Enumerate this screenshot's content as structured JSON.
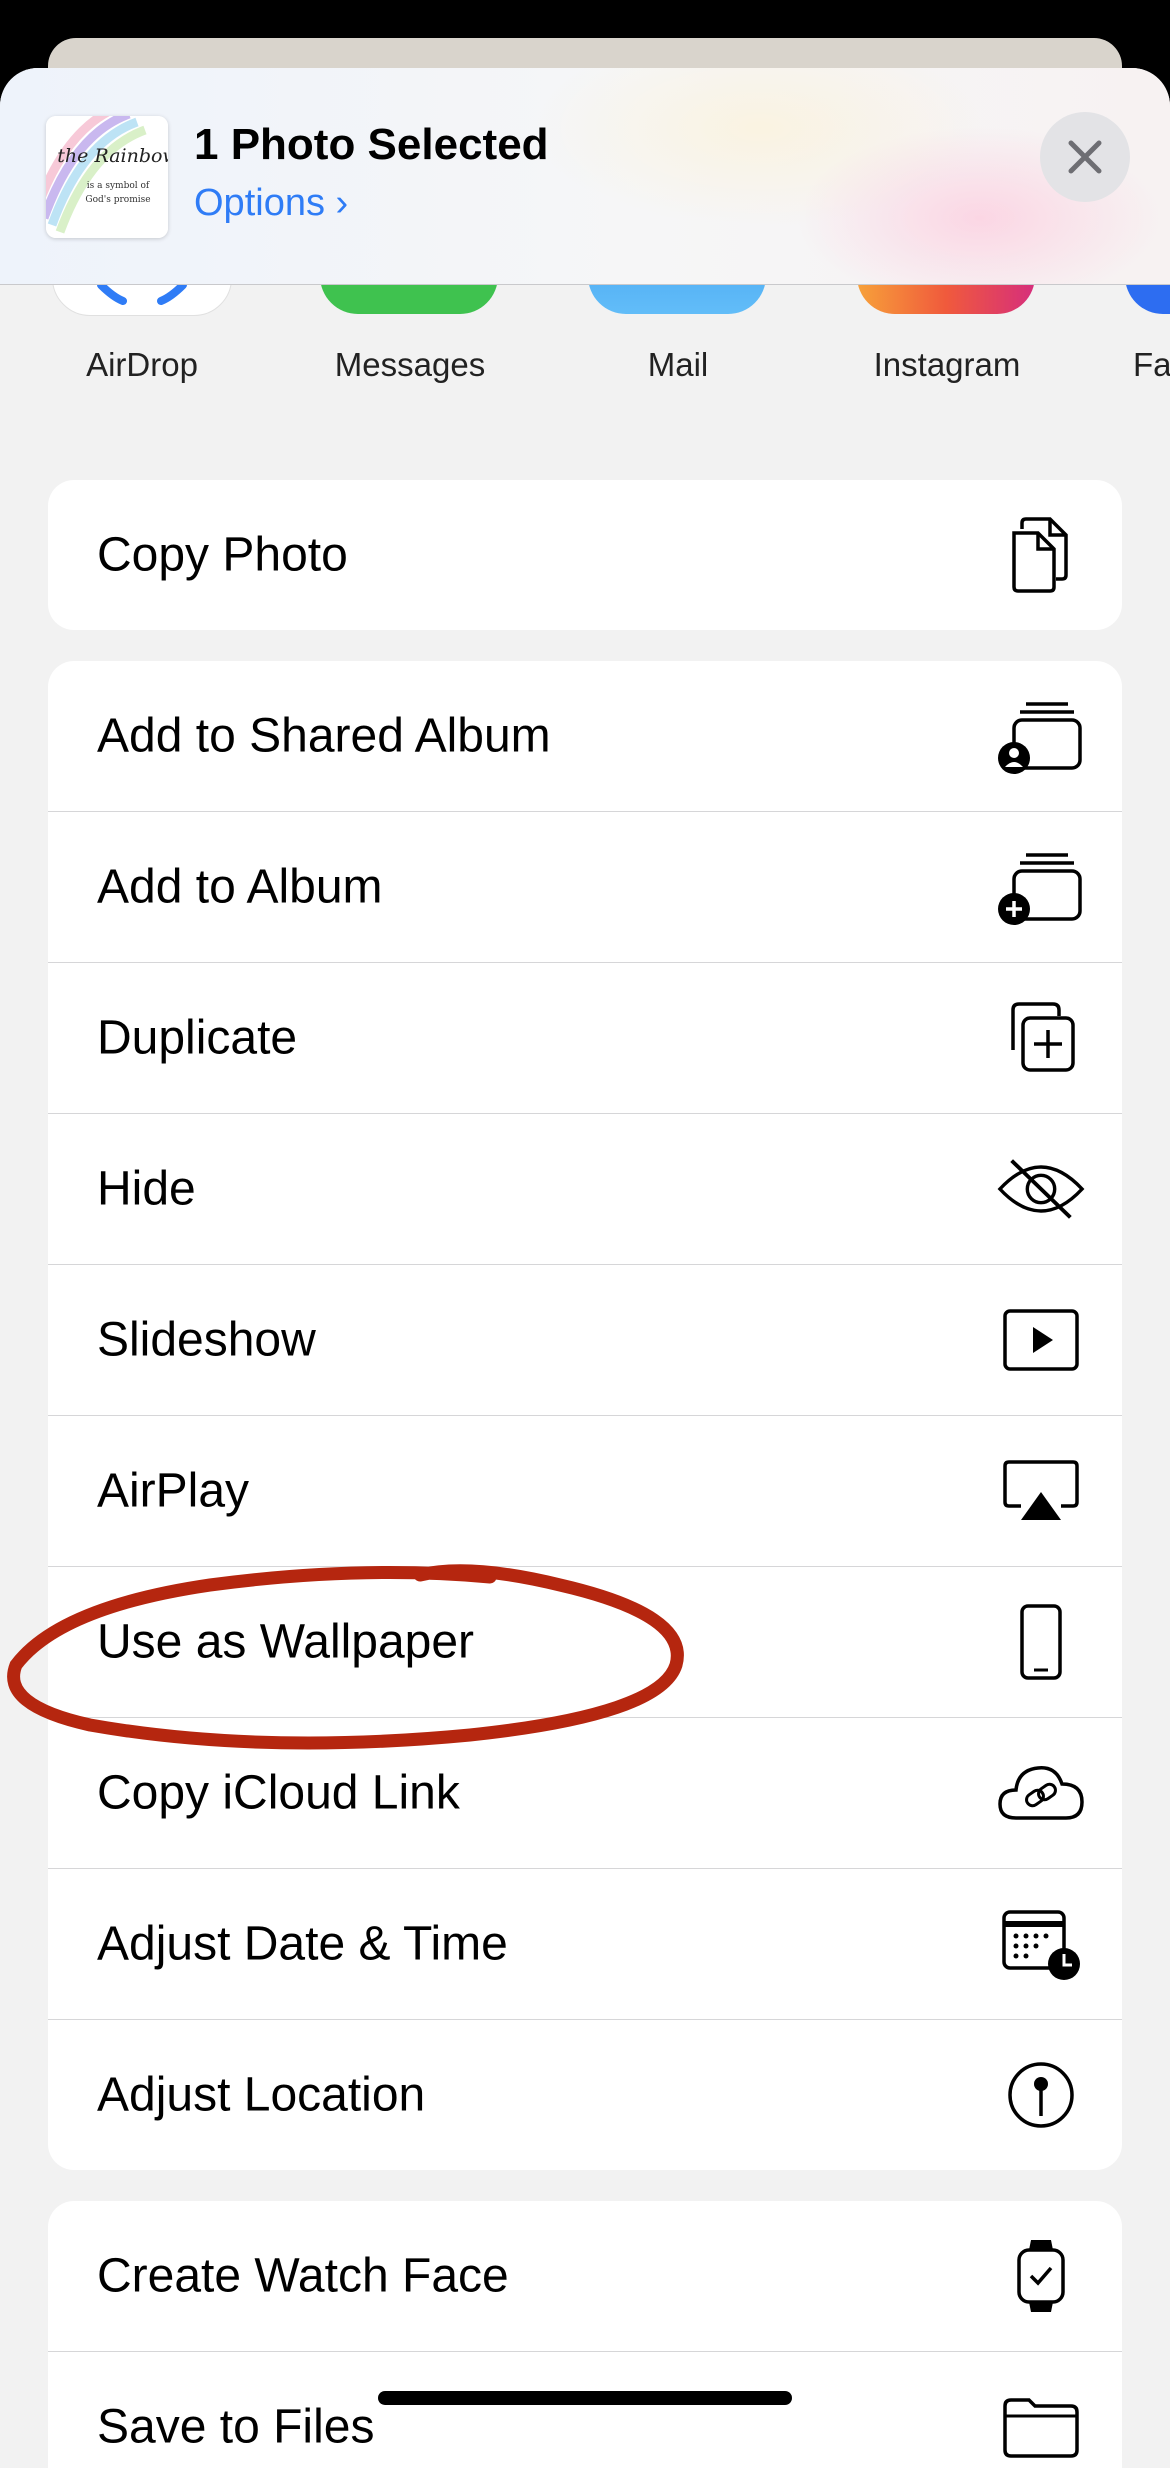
{
  "header": {
    "title": "1 Photo Selected",
    "options_label": "Options ›",
    "thumbnail": {
      "script_word": "the Rainbow",
      "line1": "is a symbol of",
      "line2": "God's promise"
    }
  },
  "apps": [
    {
      "label": "AirDrop",
      "color": "#ffffff"
    },
    {
      "label": "Messages",
      "color": "#3fc24f"
    },
    {
      "label": "Mail",
      "color": "#55b4f7"
    },
    {
      "label": "Instagram",
      "color": "#f05a3c"
    },
    {
      "label": "Fa",
      "color": "#2d6df1"
    }
  ],
  "group1": [
    {
      "label": "Copy Photo",
      "icon": "copy-icon"
    }
  ],
  "group2": [
    {
      "label": "Add to Shared Album",
      "icon": "shared-album-icon"
    },
    {
      "label": "Add to Album",
      "icon": "add-album-icon"
    },
    {
      "label": "Duplicate",
      "icon": "duplicate-icon"
    },
    {
      "label": "Hide",
      "icon": "eye-slash-icon"
    },
    {
      "label": "Slideshow",
      "icon": "play-icon"
    },
    {
      "label": "AirPlay",
      "icon": "airplay-icon"
    },
    {
      "label": "Use as Wallpaper",
      "icon": "phone-icon"
    },
    {
      "label": "Copy iCloud Link",
      "icon": "cloud-link-icon"
    },
    {
      "label": "Adjust Date & Time",
      "icon": "calendar-clock-icon"
    },
    {
      "label": "Adjust Location",
      "icon": "location-pin-icon"
    }
  ],
  "group3": [
    {
      "label": "Create Watch Face",
      "icon": "watch-icon"
    },
    {
      "label": "Save to Files",
      "icon": "folder-icon"
    }
  ],
  "colors": {
    "accent": "#2f7cf6",
    "annotation": "#b5260f"
  }
}
